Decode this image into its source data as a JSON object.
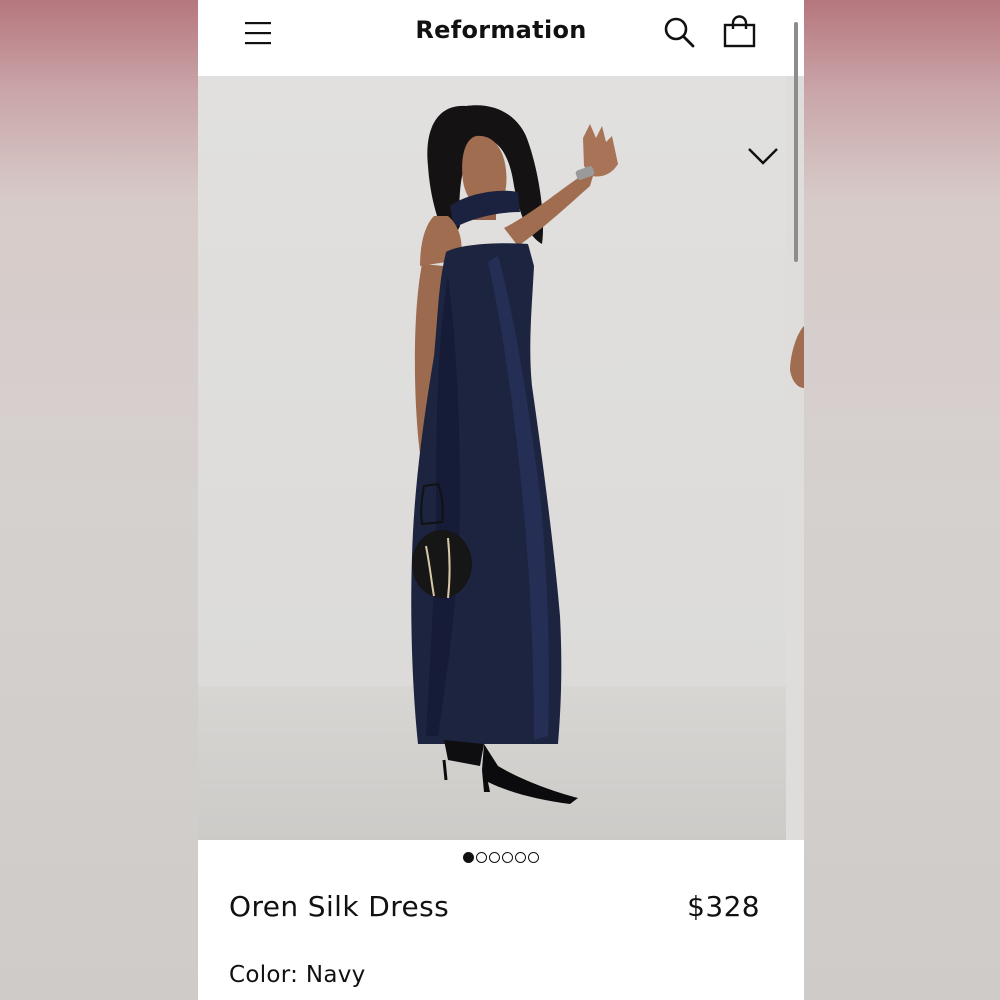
{
  "header": {
    "brand": "Reformation",
    "menu_icon": "hamburger-menu-icon",
    "search_icon": "search-icon",
    "bag_icon": "shopping-bag-icon"
  },
  "gallery": {
    "image_count": 6,
    "active_index": 0,
    "collapse_icon": "chevron-down-icon"
  },
  "product": {
    "name": "Oren Silk Dress",
    "price": "$328",
    "color_label": "Color:",
    "color_value": "Navy"
  },
  "colors": {
    "dress": "#1c2440",
    "background_top": "#b6767d"
  }
}
